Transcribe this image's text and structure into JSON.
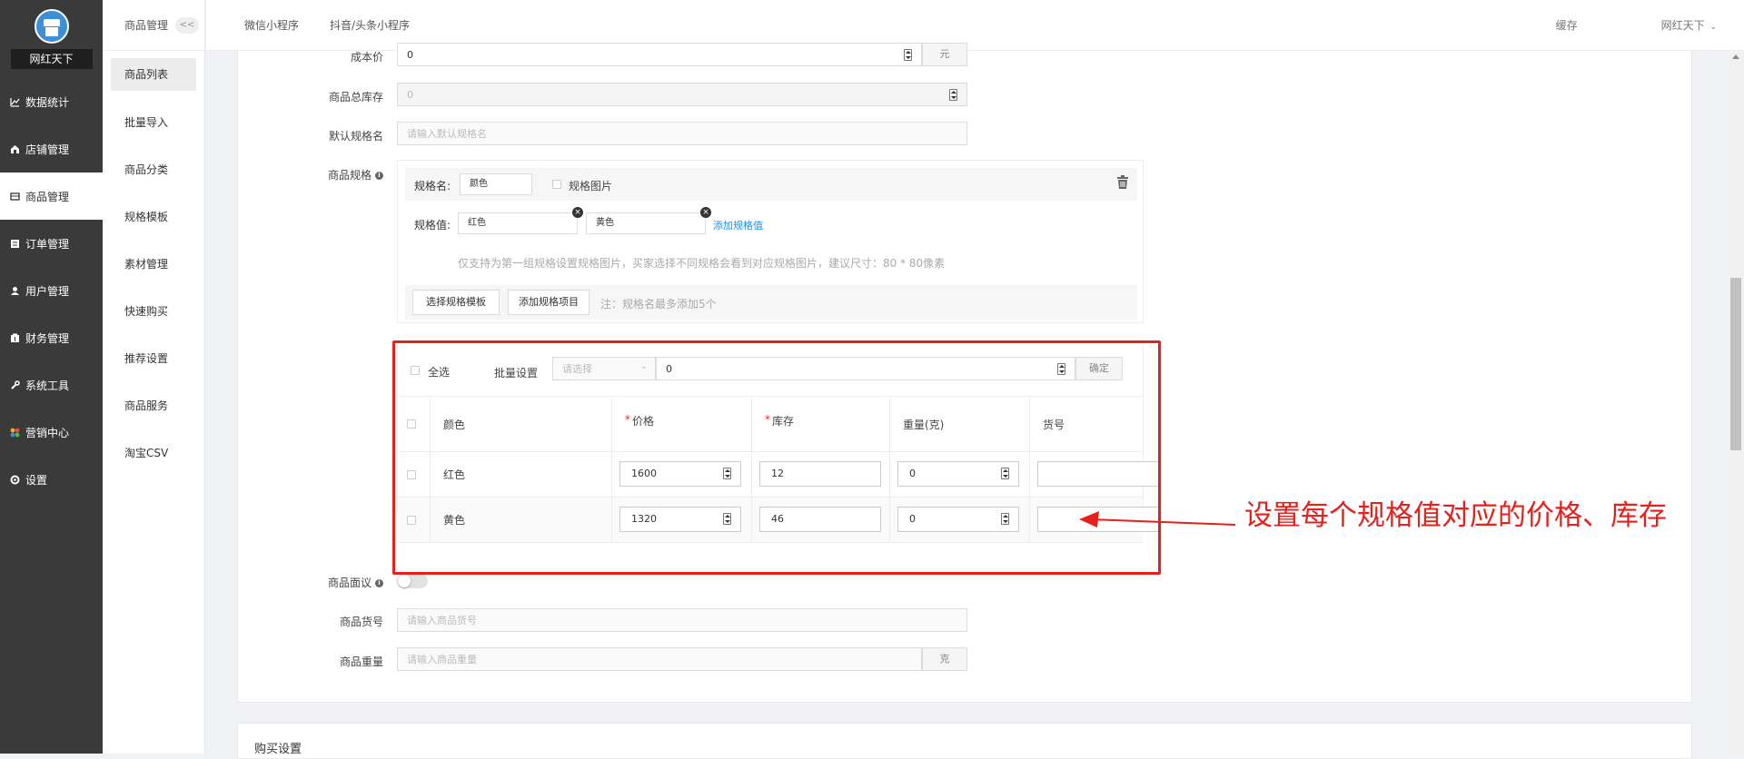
{
  "sidebar": {
    "brand": "网红天下",
    "items": [
      {
        "label": "数据统计",
        "icon": "chart-icon"
      },
      {
        "label": "店铺管理",
        "icon": "shop-icon"
      },
      {
        "label": "商品管理",
        "icon": "goods-icon"
      },
      {
        "label": "订单管理",
        "icon": "order-icon"
      },
      {
        "label": "用户管理",
        "icon": "user-icon"
      },
      {
        "label": "财务管理",
        "icon": "finance-icon"
      },
      {
        "label": "系统工具",
        "icon": "wrench-icon"
      },
      {
        "label": "营销中心",
        "icon": "marketing-icon"
      },
      {
        "label": "设置",
        "icon": "gear-icon"
      }
    ]
  },
  "subnav": {
    "title": "商品管理",
    "collapse": "<<",
    "items": [
      "商品列表",
      "批量导入",
      "商品分类",
      "规格模板",
      "素材管理",
      "快速购买",
      "推荐设置",
      "商品服务",
      "淘宝CSV"
    ]
  },
  "topbar": {
    "tabs": [
      "微信小程序",
      "抖音/头条小程序"
    ],
    "cache": "缓存",
    "user": "网红天下"
  },
  "form": {
    "cost_label": "成本价",
    "cost_value": "0",
    "cost_unit": "元",
    "stock_label": "商品总库存",
    "stock_value": "0",
    "default_spec_label": "默认规格名",
    "default_spec_placeholder": "请输入默认规格名",
    "spec_label": "商品规格",
    "spec_name_label": "规格名:",
    "spec_name_value": "颜色",
    "spec_image_label": "规格图片",
    "spec_value_label": "规格值:",
    "spec_values": [
      "红色",
      "黄色"
    ],
    "add_spec_value": "添加规格值",
    "spec_hint": "仅支持为第一组规格设置规格图片，买家选择不同规格会看到对应规格图片，建议尺寸：80 * 80像素",
    "choose_template": "选择规格模板",
    "add_spec_item": "添加规格项目",
    "spec_note": "注：规格名最多添加5个",
    "negotiable_label": "商品面议",
    "sku_code_label": "商品货号",
    "sku_code_placeholder": "请输入商品货号",
    "weight_label": "商品重量",
    "weight_placeholder": "请输入商品重量",
    "weight_unit": "克"
  },
  "sku_table": {
    "select_all": "全选",
    "batch_label": "批量设置",
    "batch_select_placeholder": "请选择",
    "batch_value": "0",
    "confirm": "确定",
    "headers": [
      "颜色",
      "价格",
      "库存",
      "重量(克)",
      "货号"
    ],
    "rows": [
      {
        "color": "红色",
        "price": "1600",
        "stock": "12",
        "weight": "0",
        "code": ""
      },
      {
        "color": "黄色",
        "price": "1320",
        "stock": "46",
        "weight": "0",
        "code": ""
      }
    ]
  },
  "annotation": "设置每个规格值对应的价格、库存",
  "section2_title": "购买设置",
  "colors": {
    "annotation": "#e8201c",
    "link": "#1890ff",
    "sidebar": "#3a3a3a"
  }
}
